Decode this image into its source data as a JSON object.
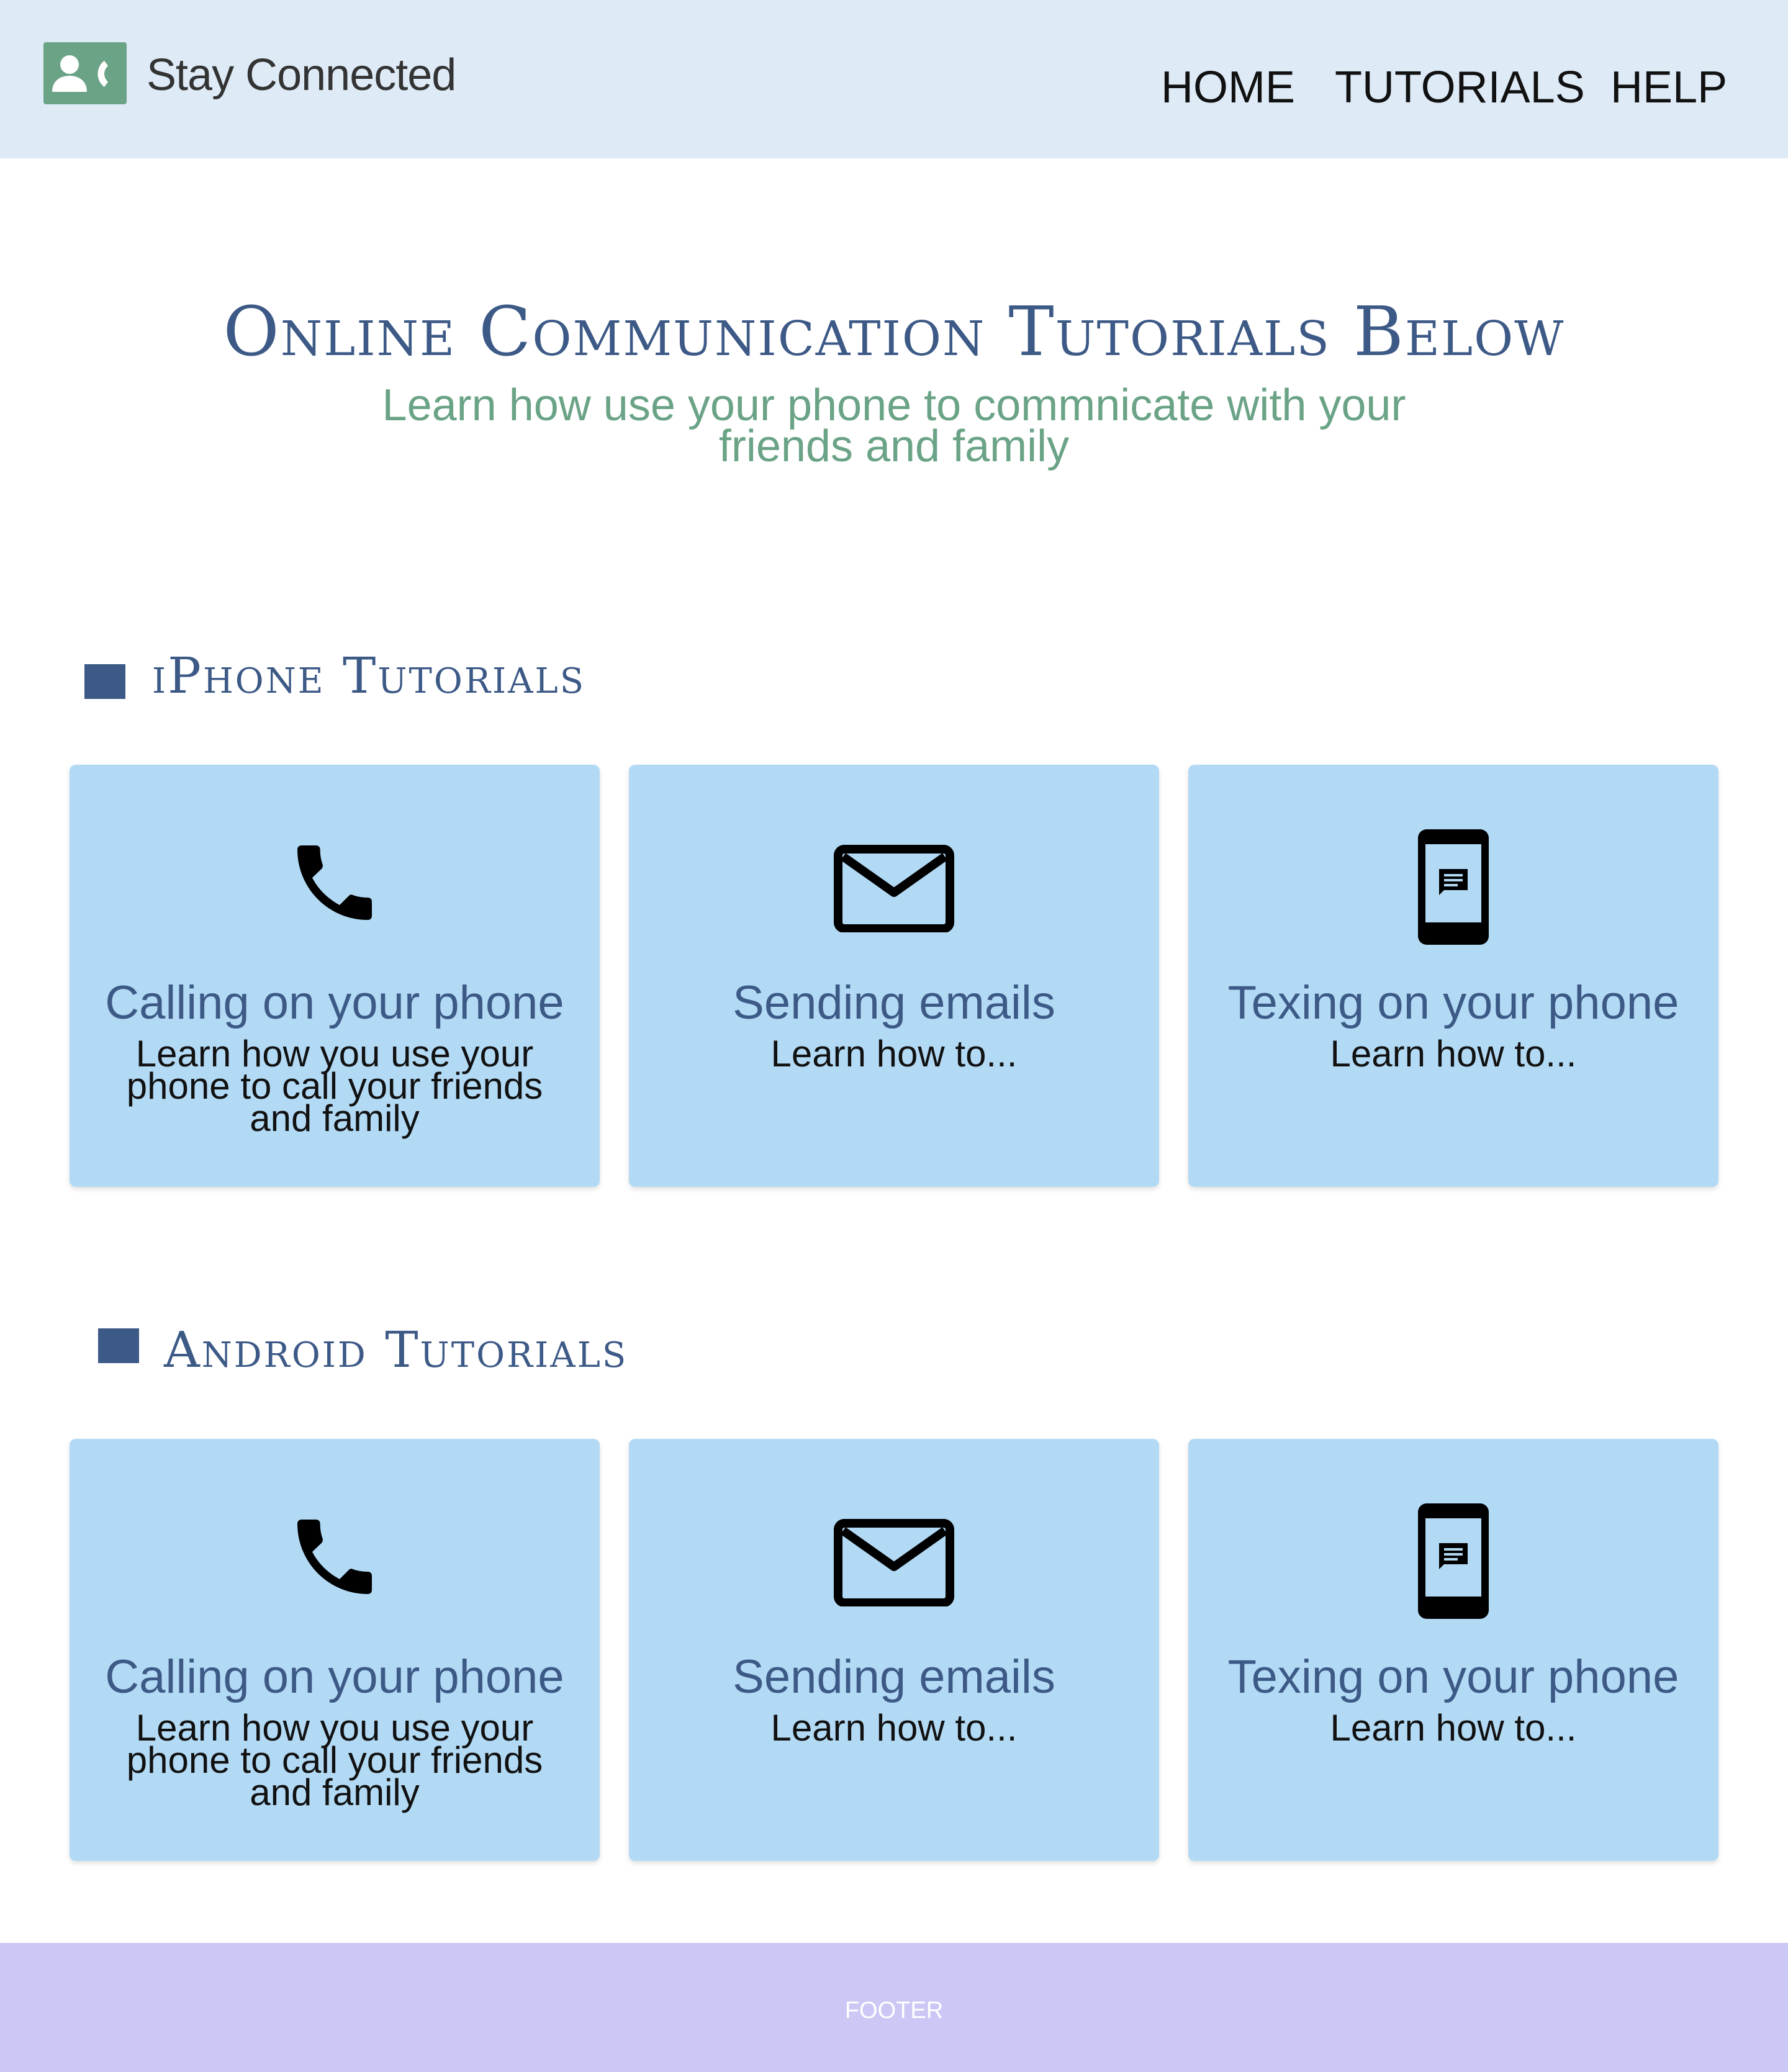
{
  "header": {
    "brand": "Stay Connected",
    "nav": [
      "HOME",
      "TUTORIALS",
      "HELP"
    ]
  },
  "hero": {
    "title": "Online Communication Tutorials Below",
    "subtitle": "Learn how use your phone to commnicate with your friends and family"
  },
  "sections": [
    {
      "title": "iPhone Tutorials",
      "cards": [
        {
          "icon": "phone-icon",
          "title": "Calling on your phone",
          "desc": "Learn how you use your phone to call your friends and family"
        },
        {
          "icon": "mail-icon",
          "title": "Sending emails",
          "desc": "Learn how to..."
        },
        {
          "icon": "smartphone-message-icon",
          "title": "Texing on your phone",
          "desc": "Learn how to..."
        }
      ]
    },
    {
      "title": "Android Tutorials",
      "cards": [
        {
          "icon": "phone-icon",
          "title": "Calling on your phone",
          "desc": "Learn how you use your phone to call your friends and family"
        },
        {
          "icon": "mail-icon",
          "title": "Sending emails",
          "desc": "Learn how to..."
        },
        {
          "icon": "smartphone-message-icon",
          "title": "Texing on your phone",
          "desc": "Learn how to..."
        }
      ]
    }
  ],
  "footer": {
    "text": "FOOTER"
  },
  "colors": {
    "header_bg": "#deebf7",
    "brand_green": "#6aa386",
    "accent_blue": "#3d5a87",
    "card_bg": "#b3daf5",
    "footer_bg": "#ccc8f5"
  }
}
